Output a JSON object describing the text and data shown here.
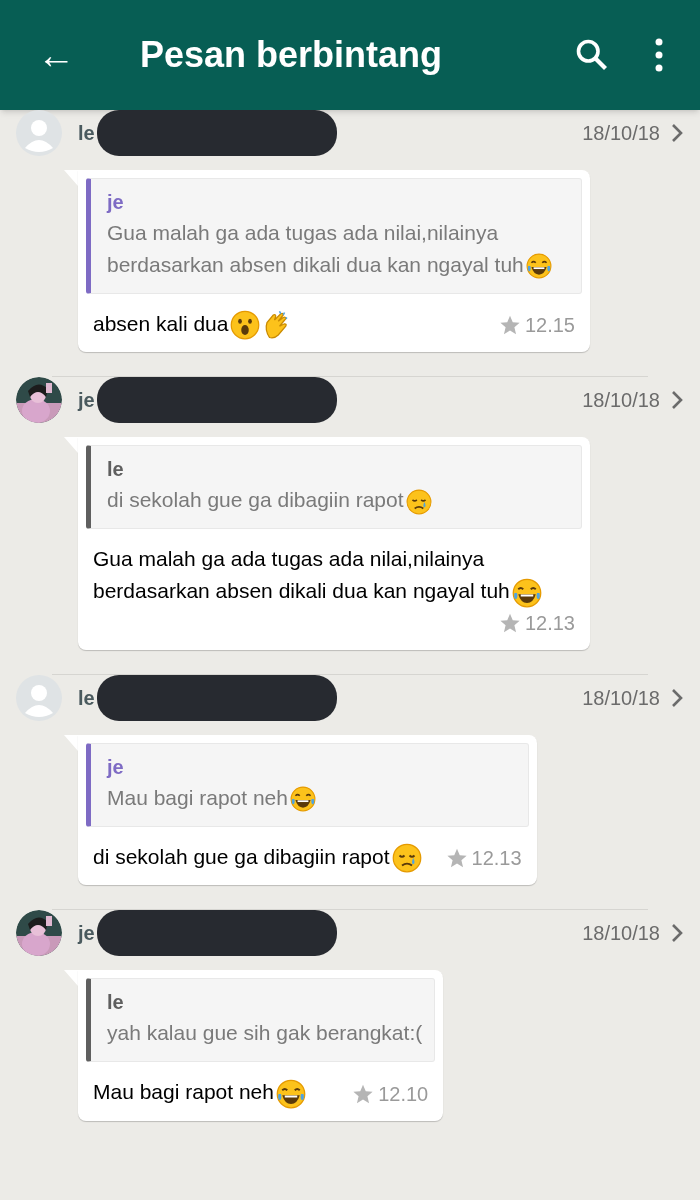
{
  "header": {
    "back_icon": "←",
    "title": "Pesan berbintang"
  },
  "messages": [
    {
      "sender": {
        "name": "le",
        "avatar": {
          "kind": "default"
        }
      },
      "date": "18/10/18",
      "quote": {
        "author": "je",
        "color": "#7e6bc4",
        "text": "Gua malah ga ada tugas ada nilai,nilainya berdasarkan absen dikali dua kan ngayal tuh",
        "emojis": [
          {
            "kind": "laugh"
          }
        ]
      },
      "text": "absen kali dua",
      "emojis": [
        {
          "kind": "surprised"
        },
        {
          "kind": "clap"
        }
      ],
      "time": "12.15",
      "starred": true
    },
    {
      "sender": {
        "name": "je"
      },
      "date": "18/10/18",
      "quote": {
        "author": "le",
        "color": "#5f5f5f",
        "text": "di sekolah gue ga dibagiin rapot",
        "emojis": [
          {
            "kind": "sad"
          }
        ]
      },
      "text": "Gua malah ga ada tugas ada nilai,nilainya berdasarkan absen dikali dua kan ngayal tuh",
      "emojis": [
        {
          "kind": "laugh"
        }
      ],
      "time": "12.13",
      "starred": true
    },
    {
      "sender": {
        "name": "le",
        "avatar": {
          "kind": "default"
        }
      },
      "date": "18/10/18",
      "quote": {
        "author": "je",
        "color": "#7e6bc4",
        "text": "Mau bagi rapot neh",
        "emojis": [
          {
            "kind": "laugh"
          }
        ]
      },
      "text": "di sekolah gue ga dibagiin rapot",
      "emojis": [
        {
          "kind": "sad"
        }
      ],
      "time": "12.13",
      "starred": true
    },
    {
      "sender": {
        "name": "je"
      },
      "date": "18/10/18",
      "quote": {
        "author": "le",
        "color": "#5f5f5f",
        "text": "yah kalau gue sih gak berangkat:("
      },
      "text": "Mau bagi rapot neh",
      "emojis": [
        {
          "kind": "laugh"
        }
      ],
      "time": "12.10",
      "starred": true
    }
  ]
}
